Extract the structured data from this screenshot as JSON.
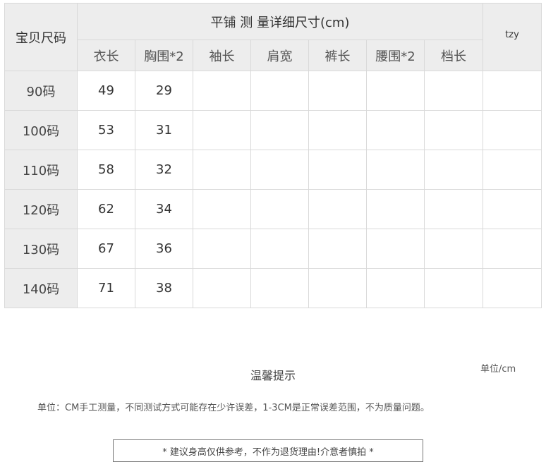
{
  "table": {
    "size_header": "宝贝尺码",
    "measure_title": "平铺 测 量详细尺寸(cm)",
    "tag": "tzy",
    "columns": [
      "衣长",
      "胸围*2",
      "袖长",
      "肩宽",
      "裤长",
      "腰围*2",
      "档长"
    ],
    "rows": [
      {
        "size": "90码",
        "cells": [
          "49",
          "29",
          "",
          "",
          "",
          "",
          ""
        ]
      },
      {
        "size": "100码",
        "cells": [
          "53",
          "31",
          "",
          "",
          "",
          "",
          ""
        ]
      },
      {
        "size": "110码",
        "cells": [
          "58",
          "32",
          "",
          "",
          "",
          "",
          ""
        ]
      },
      {
        "size": "120码",
        "cells": [
          "62",
          "34",
          "",
          "",
          "",
          "",
          ""
        ]
      },
      {
        "size": "130码",
        "cells": [
          "67",
          "36",
          "",
          "",
          "",
          "",
          ""
        ]
      },
      {
        "size": "140码",
        "cells": [
          "71",
          "38",
          "",
          "",
          "",
          "",
          ""
        ]
      }
    ]
  },
  "tips": {
    "title": "温馨提示",
    "unit": "单位/cm",
    "note": "单位：CM手工测量，不同测试方式可能存在少许误差，1-3CM是正常误差范围，不为质量问题。",
    "advice": "* 建议身高仅供参考，不作为退货理由!介意者慎拍 *"
  },
  "colors": {
    "header_bg": "#ededed",
    "border": "#d9d9d9",
    "text": "#333333"
  }
}
